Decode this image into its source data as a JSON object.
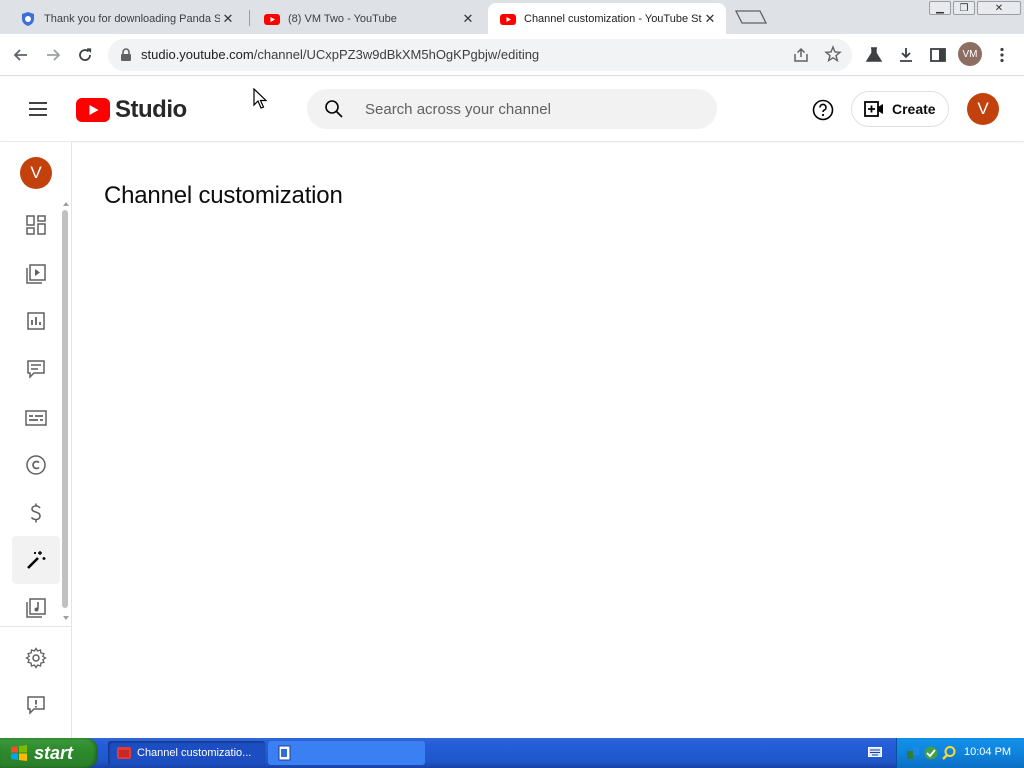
{
  "browser": {
    "tabs": [
      {
        "title": "Thank you for downloading Panda S",
        "favicon": "panda-shield-icon",
        "active": false
      },
      {
        "title": "(8) VM Two - YouTube",
        "favicon": "youtube-icon",
        "active": false
      },
      {
        "title": "Channel customization - YouTube St",
        "favicon": "youtube-icon",
        "active": true
      }
    ],
    "url_host": "studio.youtube.com",
    "url_path": "/channel/UCxpPZ3w9dBkXM5hOgKPgbjw/editing",
    "profile_initials": "VM"
  },
  "studio": {
    "logo_text": "Studio",
    "search_placeholder": "Search across your channel",
    "create_label": "Create",
    "avatar_initial": "V"
  },
  "sidebar": {
    "avatar_initial": "V",
    "items": [
      {
        "name": "dashboard-icon"
      },
      {
        "name": "content-icon"
      },
      {
        "name": "analytics-icon"
      },
      {
        "name": "comments-icon"
      },
      {
        "name": "subtitles-icon"
      },
      {
        "name": "copyright-icon"
      },
      {
        "name": "earn-icon"
      },
      {
        "name": "customization-icon",
        "active": true
      },
      {
        "name": "audio-library-icon"
      },
      {
        "name": "settings-icon"
      },
      {
        "name": "send-feedback-icon"
      }
    ]
  },
  "main": {
    "title": "Channel customization"
  },
  "taskbar": {
    "start_label": "start",
    "tasks": [
      {
        "label": "Channel customizatio...",
        "icon": "chrome-icon"
      },
      {
        "label": "",
        "icon": "document-icon"
      }
    ],
    "clock": "10:04 PM"
  },
  "colors": {
    "youtube_red": "#ff0000",
    "avatar": "#c2410c",
    "xp_taskbar": "#245edb",
    "xp_start": "#2d8b2d"
  }
}
